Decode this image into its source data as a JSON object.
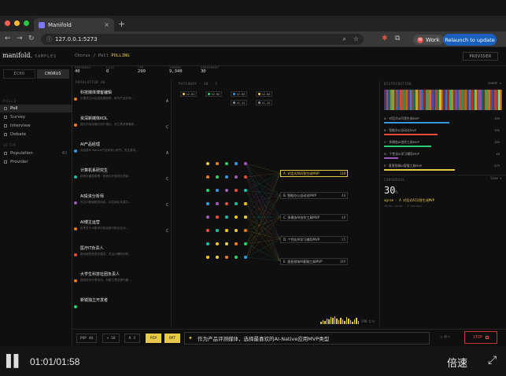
{
  "browser": {
    "tab_title": "Manifold",
    "url": "127.0.0.1:5273",
    "profile_label": "Work",
    "profile_initial": "W",
    "relaunch_label": "Relaunch to update"
  },
  "app": {
    "logo": "manifold.",
    "logo_sub": "SAMPLES",
    "breadcrumb_parent": "Chorus",
    "breadcrumb_sep": "/",
    "breadcrumb_current": "Poll",
    "breadcrumb_status": "POLLING",
    "provider_label": "PROVIDER"
  },
  "sidebar": {
    "modes": [
      "ECHO",
      "CHORUS"
    ],
    "items": [
      {
        "label": "Poll",
        "active": true
      },
      {
        "label": "Survey"
      },
      {
        "label": "Interview"
      },
      {
        "label": "Debate"
      }
    ],
    "items2": [
      {
        "label": "Population",
        "count": "40"
      },
      {
        "label": "Provider"
      }
    ]
  },
  "stats": [
    {
      "key": "PERSONAS",
      "value": "40"
    },
    {
      "key": "LIVE",
      "value": "0"
    },
    {
      "key": "TPS",
      "value": "290"
    },
    {
      "key": "TOKENS",
      "value": "9,340"
    },
    {
      "key": "AGREEMENT",
      "value": "30"
    }
  ],
  "population": {
    "header": "POPULATION",
    "count": "40",
    "personas": [
      {
        "name": "科技媒体博客编辑",
        "desc": "长期关注AI应用发展趋势，常写产品评测…",
        "tag": "A",
        "color": "#e67e22"
      },
      {
        "name": "资深新媒体KOL",
        "desc": "擅长内容传播与用户增长，对工具效率敏感…",
        "tag": "C",
        "color": "#e67e22"
      },
      {
        "name": "AI产品经理",
        "desc": "对各类AI Native产品有深入研究，关注落地…",
        "tag": "A",
        "color": "#3498db"
      },
      {
        "name": "计算机系研究生",
        "desc": "熟悉大模型原理，常参与开源项目贡献…",
        "tag": "C",
        "color": "#1abc9c"
      },
      {
        "name": "AI投资分析师",
        "desc": "关注AI赛道融资动态，评估商业化潜力…",
        "tag": "C",
        "color": "#9b59b6"
      },
      {
        "name": "AI博主运营",
        "desc": "负责多个AI账号内容运营与粉丝互动…",
        "tag": "C",
        "color": "#e67e22"
      },
      {
        "name": "医疗IT负责人",
        "desc": "推动医院信息化建设，关注AI辅助诊断…",
        "tag": "",
        "color": "#e74c3c"
      },
      {
        "name": "大学生科技社团负责人",
        "desc": "组织技术分享活动，对新工具充满兴趣…",
        "tag": "",
        "color": "#e67e22"
      },
      {
        "name": "新锐独立开发者",
        "desc": "",
        "tag": "",
        "color": "#2ecc71"
      }
    ]
  },
  "network": {
    "header": "PATCHWAY",
    "header_meta": "40 · 5",
    "chips": [
      {
        "label": "c2-01",
        "color": "#e6c84a"
      },
      {
        "label": "c2-02",
        "color": "#2ecc71"
      },
      {
        "label": "c2-03",
        "color": "#3498db"
      },
      {
        "label": "c2-04",
        "color": "#e6c84a"
      },
      {
        "label": "c1-11",
        "color": "#888888"
      },
      {
        "label": "c1-12",
        "color": "#888888"
      }
    ],
    "options": [
      {
        "label": "A. 对话式AI问答生成MVP",
        "count": "118",
        "top": true
      },
      {
        "label": "B. 智能办公自动化MVP",
        "count": "40"
      },
      {
        "label": "C. 多模态AI创作工具MVP",
        "count": "48"
      },
      {
        "label": "D. 个性化AI学习辅导MVP",
        "count": "15"
      },
      {
        "label": "E. 垂直领域AI客服工具MVP",
        "count": "109"
      }
    ],
    "rate": "290 t/s"
  },
  "distribution": {
    "header": "DISTRIBUTION",
    "select": "count",
    "rows": [
      {
        "label": "A · 对话式AI问答生成MVP",
        "pct": "13%",
        "color": "#3498db",
        "value": 0.55
      },
      {
        "label": "B · 智能办公自动化MVP",
        "pct": "13%",
        "color": "#e74c3c",
        "value": 0.45
      },
      {
        "label": "C · 多模态AI创作工具MVP",
        "pct": "13%",
        "color": "#2ecc71",
        "value": 0.4
      },
      {
        "label": "D · 个性化AI学习辅导MVP",
        "pct": "4%",
        "color": "#9b59b6",
        "value": 0.12
      },
      {
        "label": "E · 垂直领域AI客服工具MVP",
        "pct": "27%",
        "color": "#e6c84a",
        "value": 0.6
      }
    ],
    "consensus_label": "CONSENSUS",
    "consensus_value": "30",
    "consensus_unit": "%",
    "consensus_select": "live",
    "consensus_answer": "agree · A 对话式AI问答生成MVP",
    "consensus_meta": "40/40 voted · 5 options"
  },
  "bottom": {
    "pop_label": "POP",
    "pop_value": "40",
    "rounds": "10",
    "k_label": "K",
    "k_value": "3",
    "btn1": "PIP",
    "btn2": "OPT",
    "prompt": "作为产品评测媒体，选择最喜欢的AI-Native应用MVP类型",
    "stop": "STOP"
  },
  "player": {
    "time": "01:01/01:58",
    "speed": "倍速"
  }
}
